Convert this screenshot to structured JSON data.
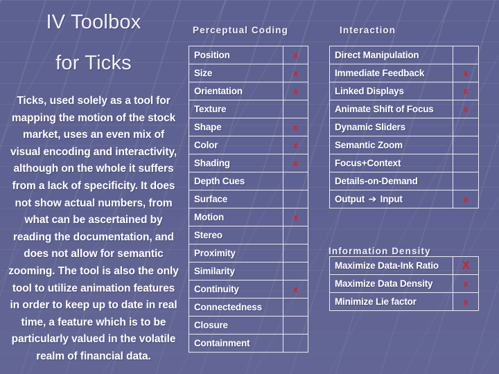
{
  "slide": {
    "title_line1": "IV Toolbox",
    "title_line2": "for Ticks",
    "body": "Ticks, used solely as a tool for mapping the motion of the stock market, uses an even mix of visual encoding and interactivity, although on the whole it suffers from a lack of specificity.  It does not show actual numbers, from what can be ascertained by reading the documentation, and does not allow for semantic zooming. The tool is also the only tool to utilize animation features in order to keep up to date in real time, a feature which is to be particularly valued in the volatile realm of financial data."
  },
  "colors": {
    "background_top": "#4f5182",
    "background_bottom": "#6d6f99",
    "text": "#ffffff",
    "border": "#eceaf3",
    "mark": "#d91f26"
  },
  "marks": {
    "checked": "x",
    "blank": ""
  },
  "sections": {
    "perceptual": {
      "caption": "Perceptual Coding",
      "rows": [
        {
          "label": "Position",
          "mark": "x"
        },
        {
          "label": "Size",
          "mark": "x"
        },
        {
          "label": "Orientation",
          "mark": "x"
        },
        {
          "label": "Texture",
          "mark": ""
        },
        {
          "label": "Shape",
          "mark": "x"
        },
        {
          "label": "Color",
          "mark": "x"
        },
        {
          "label": "Shading",
          "mark": "x"
        },
        {
          "label": "Depth Cues",
          "mark": ""
        },
        {
          "label": "Surface",
          "mark": ""
        },
        {
          "label": "Motion",
          "mark": "x"
        },
        {
          "label": "Stereo",
          "mark": ""
        },
        {
          "label": "Proximity",
          "mark": ""
        },
        {
          "label": "Similarity",
          "mark": ""
        },
        {
          "label": "Continuity",
          "mark": "x"
        },
        {
          "label": "Connectedness",
          "mark": ""
        },
        {
          "label": "Closure",
          "mark": ""
        },
        {
          "label": "Containment",
          "mark": ""
        }
      ]
    },
    "interaction": {
      "caption": "Interaction",
      "rows": [
        {
          "label": "Direct Manipulation",
          "mark": ""
        },
        {
          "label": "Immediate Feedback",
          "mark": "x"
        },
        {
          "label": "Linked Displays",
          "mark": "x"
        },
        {
          "label": "Animate Shift of Focus",
          "mark": "x"
        },
        {
          "label": "Dynamic Sliders",
          "mark": ""
        },
        {
          "label": "Semantic Zoom",
          "mark": ""
        },
        {
          "label": "Focus+Context",
          "mark": ""
        },
        {
          "label": "Details-on-Demand",
          "mark": ""
        },
        {
          "label": "Output ➔ Input",
          "mark": "x"
        }
      ]
    },
    "density": {
      "caption": "Information Density",
      "rows": [
        {
          "label": "Maximize Data-Ink Ratio",
          "mark": "X"
        },
        {
          "label": "Maximize Data Density",
          "mark": "x"
        },
        {
          "label": "Minimize Lie factor",
          "mark": "x"
        }
      ]
    }
  }
}
